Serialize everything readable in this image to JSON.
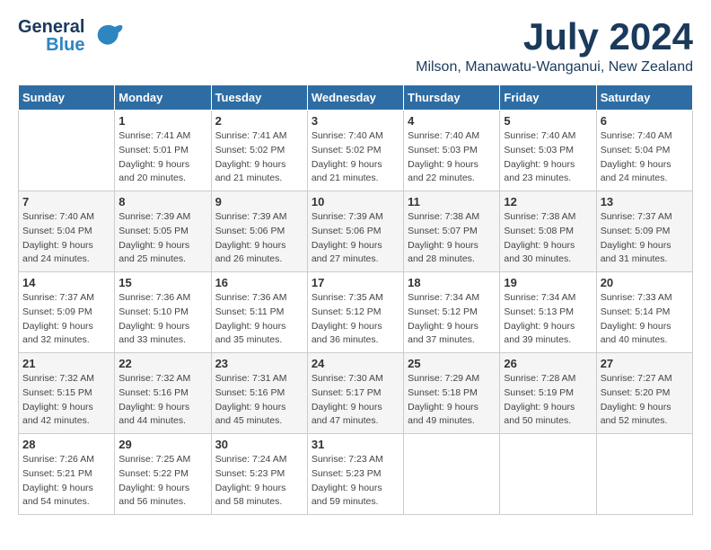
{
  "logo": {
    "general": "General",
    "blue": "Blue"
  },
  "title": {
    "month_year": "July 2024",
    "location": "Milson, Manawatu-Wanganui, New Zealand"
  },
  "days_of_week": [
    "Sunday",
    "Monday",
    "Tuesday",
    "Wednesday",
    "Thursday",
    "Friday",
    "Saturday"
  ],
  "weeks": [
    [
      {
        "day": "",
        "info": ""
      },
      {
        "day": "1",
        "info": "Sunrise: 7:41 AM\nSunset: 5:01 PM\nDaylight: 9 hours\nand 20 minutes."
      },
      {
        "day": "2",
        "info": "Sunrise: 7:41 AM\nSunset: 5:02 PM\nDaylight: 9 hours\nand 21 minutes."
      },
      {
        "day": "3",
        "info": "Sunrise: 7:40 AM\nSunset: 5:02 PM\nDaylight: 9 hours\nand 21 minutes."
      },
      {
        "day": "4",
        "info": "Sunrise: 7:40 AM\nSunset: 5:03 PM\nDaylight: 9 hours\nand 22 minutes."
      },
      {
        "day": "5",
        "info": "Sunrise: 7:40 AM\nSunset: 5:03 PM\nDaylight: 9 hours\nand 23 minutes."
      },
      {
        "day": "6",
        "info": "Sunrise: 7:40 AM\nSunset: 5:04 PM\nDaylight: 9 hours\nand 24 minutes."
      }
    ],
    [
      {
        "day": "7",
        "info": "Sunrise: 7:40 AM\nSunset: 5:04 PM\nDaylight: 9 hours\nand 24 minutes."
      },
      {
        "day": "8",
        "info": "Sunrise: 7:39 AM\nSunset: 5:05 PM\nDaylight: 9 hours\nand 25 minutes."
      },
      {
        "day": "9",
        "info": "Sunrise: 7:39 AM\nSunset: 5:06 PM\nDaylight: 9 hours\nand 26 minutes."
      },
      {
        "day": "10",
        "info": "Sunrise: 7:39 AM\nSunset: 5:06 PM\nDaylight: 9 hours\nand 27 minutes."
      },
      {
        "day": "11",
        "info": "Sunrise: 7:38 AM\nSunset: 5:07 PM\nDaylight: 9 hours\nand 28 minutes."
      },
      {
        "day": "12",
        "info": "Sunrise: 7:38 AM\nSunset: 5:08 PM\nDaylight: 9 hours\nand 30 minutes."
      },
      {
        "day": "13",
        "info": "Sunrise: 7:37 AM\nSunset: 5:09 PM\nDaylight: 9 hours\nand 31 minutes."
      }
    ],
    [
      {
        "day": "14",
        "info": "Sunrise: 7:37 AM\nSunset: 5:09 PM\nDaylight: 9 hours\nand 32 minutes."
      },
      {
        "day": "15",
        "info": "Sunrise: 7:36 AM\nSunset: 5:10 PM\nDaylight: 9 hours\nand 33 minutes."
      },
      {
        "day": "16",
        "info": "Sunrise: 7:36 AM\nSunset: 5:11 PM\nDaylight: 9 hours\nand 35 minutes."
      },
      {
        "day": "17",
        "info": "Sunrise: 7:35 AM\nSunset: 5:12 PM\nDaylight: 9 hours\nand 36 minutes."
      },
      {
        "day": "18",
        "info": "Sunrise: 7:34 AM\nSunset: 5:12 PM\nDaylight: 9 hours\nand 37 minutes."
      },
      {
        "day": "19",
        "info": "Sunrise: 7:34 AM\nSunset: 5:13 PM\nDaylight: 9 hours\nand 39 minutes."
      },
      {
        "day": "20",
        "info": "Sunrise: 7:33 AM\nSunset: 5:14 PM\nDaylight: 9 hours\nand 40 minutes."
      }
    ],
    [
      {
        "day": "21",
        "info": "Sunrise: 7:32 AM\nSunset: 5:15 PM\nDaylight: 9 hours\nand 42 minutes."
      },
      {
        "day": "22",
        "info": "Sunrise: 7:32 AM\nSunset: 5:16 PM\nDaylight: 9 hours\nand 44 minutes."
      },
      {
        "day": "23",
        "info": "Sunrise: 7:31 AM\nSunset: 5:16 PM\nDaylight: 9 hours\nand 45 minutes."
      },
      {
        "day": "24",
        "info": "Sunrise: 7:30 AM\nSunset: 5:17 PM\nDaylight: 9 hours\nand 47 minutes."
      },
      {
        "day": "25",
        "info": "Sunrise: 7:29 AM\nSunset: 5:18 PM\nDaylight: 9 hours\nand 49 minutes."
      },
      {
        "day": "26",
        "info": "Sunrise: 7:28 AM\nSunset: 5:19 PM\nDaylight: 9 hours\nand 50 minutes."
      },
      {
        "day": "27",
        "info": "Sunrise: 7:27 AM\nSunset: 5:20 PM\nDaylight: 9 hours\nand 52 minutes."
      }
    ],
    [
      {
        "day": "28",
        "info": "Sunrise: 7:26 AM\nSunset: 5:21 PM\nDaylight: 9 hours\nand 54 minutes."
      },
      {
        "day": "29",
        "info": "Sunrise: 7:25 AM\nSunset: 5:22 PM\nDaylight: 9 hours\nand 56 minutes."
      },
      {
        "day": "30",
        "info": "Sunrise: 7:24 AM\nSunset: 5:23 PM\nDaylight: 9 hours\nand 58 minutes."
      },
      {
        "day": "31",
        "info": "Sunrise: 7:23 AM\nSunset: 5:23 PM\nDaylight: 9 hours\nand 59 minutes."
      },
      {
        "day": "",
        "info": ""
      },
      {
        "day": "",
        "info": ""
      },
      {
        "day": "",
        "info": ""
      }
    ]
  ]
}
